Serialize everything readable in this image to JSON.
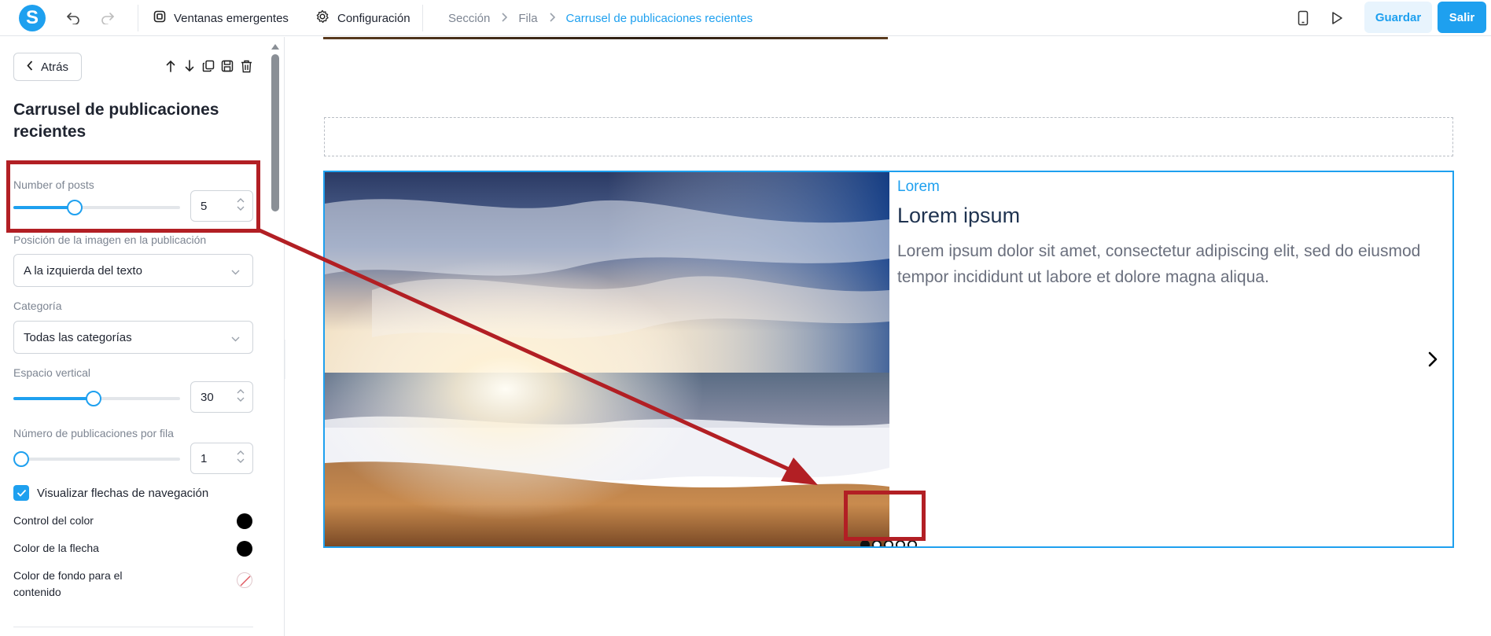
{
  "topbar": {
    "logo_letter": "S",
    "popups_label": "Ventanas emergentes",
    "settings_label": "Configuración",
    "breadcrumbs": [
      "Sección",
      "Fila",
      "Carrusel de publicaciones recientes"
    ],
    "save_label": "Guardar",
    "exit_label": "Salir"
  },
  "sidebar": {
    "back_label": "Atrás",
    "title": "Carrusel de publicaciones recientes",
    "number_of_posts": {
      "label": "Number of posts",
      "value": "5",
      "slider_fraction": 0.37
    },
    "image_position": {
      "label": "Posición de la imagen en la publicación",
      "value": "A la izquierda del texto"
    },
    "category": {
      "label": "Categoría",
      "value": "Todas las categorías"
    },
    "vertical_spacing": {
      "label": "Espacio vertical",
      "value": "30",
      "slider_fraction": 0.48
    },
    "posts_per_row": {
      "label": "Número de publicaciones por fila",
      "value": "1",
      "slider_fraction": 0.0
    },
    "show_nav_arrows": {
      "label": "Visualizar flechas de navegación",
      "checked": true
    },
    "control_color": {
      "label": "Control del color",
      "color": "#000000"
    },
    "arrow_color": {
      "label": "Color de la flecha",
      "color": "#000000"
    },
    "content_bg_color": {
      "label": "Color de fondo para el contenido",
      "color": "none"
    }
  },
  "carousel": {
    "category": "Lorem",
    "title": "Lorem ipsum",
    "body": "Lorem ipsum dolor sit amet, consectetur adipiscing elit, sed do eiusmod tempor incididunt ut labore et dolore magna aliqua.",
    "dots_total": 5,
    "dots_active_index": 0
  },
  "colors": {
    "accent": "#1ea0ef",
    "annotation": "#b21f24"
  }
}
